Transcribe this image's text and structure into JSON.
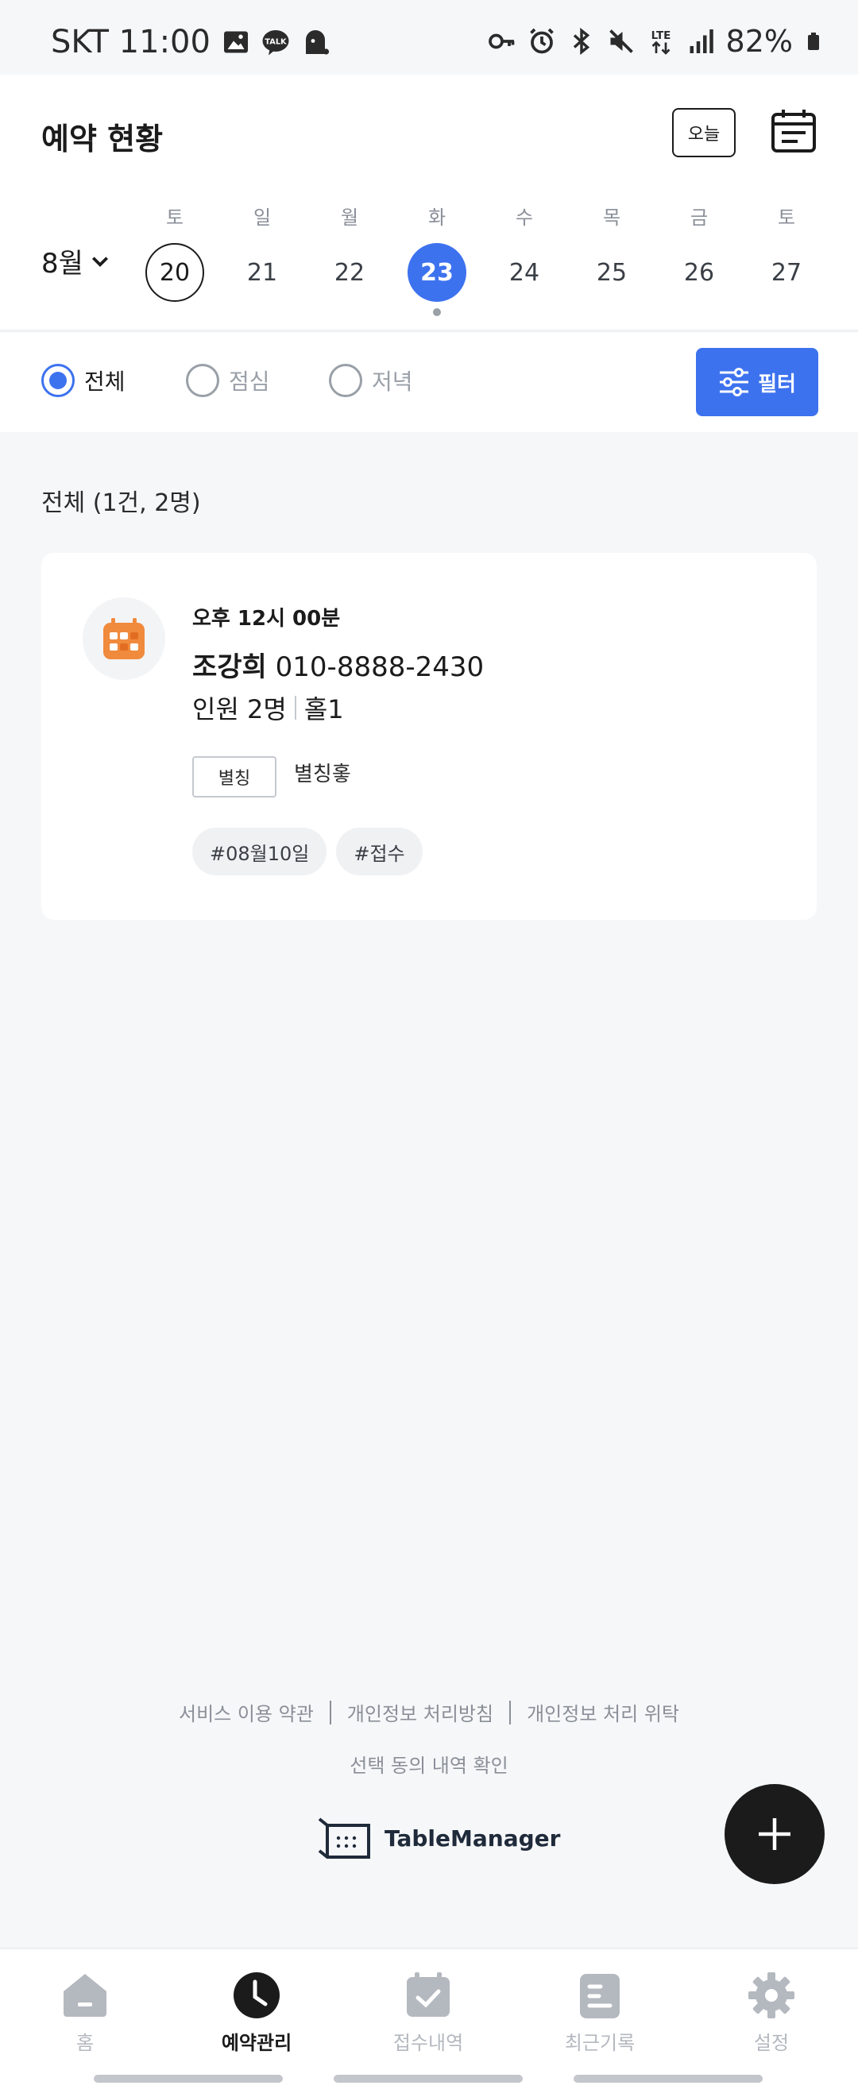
{
  "status_bar": {
    "carrier_time": "SKT 11:00",
    "battery": "82%",
    "left_icons": [
      "gallery-icon",
      "kakaotalk-icon",
      "ghost-app-icon"
    ],
    "right_icons": [
      "key-icon",
      "alarm-icon",
      "bluetooth-icon",
      "mute-icon",
      "lte-icon",
      "signal-icon",
      "battery-icon"
    ]
  },
  "header": {
    "title": "예약 현황",
    "today_label": "오늘",
    "calendar_icon": "calendar-list-icon"
  },
  "date_strip": {
    "month": "8월",
    "days": [
      {
        "weekday": "토",
        "day": "20",
        "state": "outlined"
      },
      {
        "weekday": "일",
        "day": "21",
        "state": ""
      },
      {
        "weekday": "월",
        "day": "22",
        "state": ""
      },
      {
        "weekday": "화",
        "day": "23",
        "state": "selected"
      },
      {
        "weekday": "수",
        "day": "24",
        "state": ""
      },
      {
        "weekday": "목",
        "day": "25",
        "state": ""
      },
      {
        "weekday": "금",
        "day": "26",
        "state": ""
      },
      {
        "weekday": "토",
        "day": "27",
        "state": ""
      }
    ]
  },
  "filter": {
    "options": [
      "전체",
      "점심",
      "저녁"
    ],
    "selected": "전체",
    "button_label": "필터"
  },
  "summary": "전체 (1건, 2명)",
  "reservation": {
    "time": "오후 12시 00분",
    "name": "조강희",
    "phone": "010-8888-2430",
    "party": "인원 2명",
    "table": "홀1",
    "nickname_label": "별칭",
    "nickname_value": "별칭홓",
    "tags": [
      "#08월10일",
      "#접수"
    ]
  },
  "footer": {
    "links": [
      "서비스 이용 약관",
      "개인정보 처리방침",
      "개인정보 처리 위탁"
    ],
    "consent_link": "선택 동의 내역 확인",
    "brand": "TableManager"
  },
  "bottom_nav": {
    "items": [
      {
        "label": "홈",
        "icon": "home-icon"
      },
      {
        "label": "예약관리",
        "icon": "clock-icon"
      },
      {
        "label": "접수내역",
        "icon": "calendar-check-icon"
      },
      {
        "label": "최근기록",
        "icon": "document-icon"
      },
      {
        "label": "설정",
        "icon": "gear-icon"
      }
    ],
    "active": "예약관리"
  },
  "colors": {
    "accent": "#3d72ef",
    "card_icon": "#f08a3c",
    "text_dark": "#1b1b1b",
    "muted": "#8a8f98"
  }
}
